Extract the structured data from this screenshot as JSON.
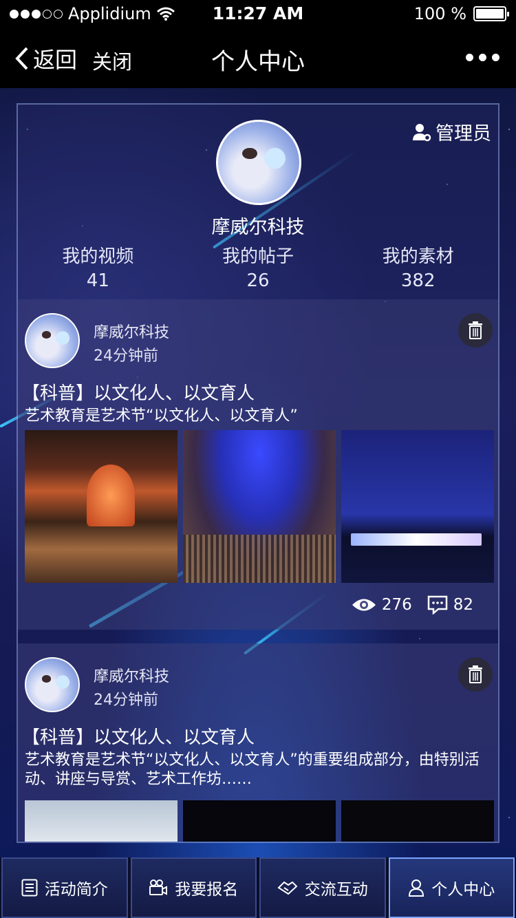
{
  "status_bar": {
    "carrier": "Applidium",
    "time": "11:27 AM",
    "battery": "100 %"
  },
  "nav": {
    "back_label": "返回",
    "close_label": "关闭",
    "title": "个人中心"
  },
  "profile": {
    "admin_label": "管理员",
    "username": "摩威尔科技",
    "stats": [
      {
        "label": "我的视频",
        "value": "41"
      },
      {
        "label": "我的帖子",
        "value": "26"
      },
      {
        "label": "我的素材",
        "value": "382"
      }
    ]
  },
  "posts": [
    {
      "author": "摩威尔科技",
      "time": "24分钟前",
      "title": "【科普】以文化人、以文育人",
      "desc": "艺术教育是艺术节“以文化人、以文育人”",
      "views": "276",
      "comments": "82"
    },
    {
      "author": "摩威尔科技",
      "time": "24分钟前",
      "title": "【科普】以文化人、以文育人",
      "desc": "艺术教育是艺术节“以文化人、以文育人”的重要组成部分，由特别活动、讲座与导赏、艺术工作坊……"
    }
  ],
  "tabs": [
    {
      "label": "活动简介",
      "icon": "list-icon"
    },
    {
      "label": "我要报名",
      "icon": "video-camera-icon"
    },
    {
      "label": "交流互动",
      "icon": "handshake-icon"
    },
    {
      "label": "个人中心",
      "icon": "user-icon"
    }
  ]
}
